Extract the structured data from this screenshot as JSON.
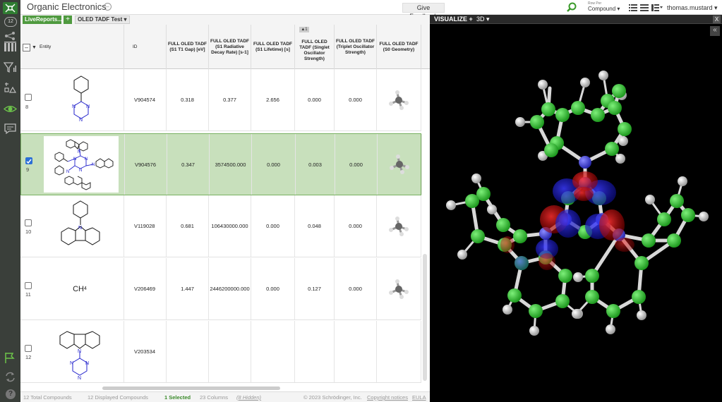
{
  "app": {
    "title": "Organic Electronics",
    "feedback": "Give Feedback",
    "row_per_label": "Row Per",
    "row_per_value": "Compound ▾",
    "user": "thomas.mustard ▾",
    "rail_badge": "12"
  },
  "tabs": {
    "livereport": "LiveReports...",
    "add": "+",
    "current": "OLED TADF Test ▾"
  },
  "grid": {
    "columns": [
      {
        "label": "Entity"
      },
      {
        "label": "ID"
      },
      {
        "label": "FULL OLED TADF (S1 T1 Gap) [eV]"
      },
      {
        "label": "FULL OLED TADF (S1 Radiative Decay Rate) [s-1]"
      },
      {
        "label": "FULL OLED TADF (S1 Lifetime) [s]"
      },
      {
        "label": "FULL OLED TADF (Singlet Oscillator Strength)"
      },
      {
        "label": "FULL OLED TADF (Triplet Oscillator Strength)"
      },
      {
        "label": "FULL OLED TADF (S0 Geometry)"
      }
    ],
    "sort_badge": "▲1",
    "rows": [
      {
        "num": "8",
        "id": "V904574",
        "gap": "0.318",
        "rate": "0.377",
        "life": "2.656",
        "sing": "0.000",
        "trip": "0.000"
      },
      {
        "num": "9",
        "id": "V904576",
        "gap": "0.347",
        "rate": "3574500.000",
        "life": "0.000",
        "sing": "0.003",
        "trip": "0.000"
      },
      {
        "num": "10",
        "id": "V119028",
        "gap": "0.681",
        "rate": "106430000.000",
        "life": "0.000",
        "sing": "0.048",
        "trip": "0.000"
      },
      {
        "num": "11",
        "id": "V206469",
        "gap": "1.447",
        "rate": "2446200000.000",
        "life": "0.000",
        "sing": "0.127",
        "trip": "0.000",
        "entity_text": "CH",
        "entity_sub": "4"
      },
      {
        "num": "12",
        "id": "V203534",
        "gap": "",
        "rate": "",
        "life": "",
        "sing": "",
        "trip": ""
      }
    ]
  },
  "status": {
    "total": "12 Total Compounds",
    "displayed": "12 Displayed Compounds",
    "selected": "1 Selected",
    "columns": "23 Columns",
    "hidden": "(8 Hidden)",
    "copyright": "© 2023 Schrödinger, Inc.",
    "notices": "Copyright notices",
    "eula": "EULA"
  },
  "viz": {
    "label": "VISUALIZE +",
    "mode": "3D ▾",
    "close": "X",
    "collapse": "«"
  },
  "colors": {
    "accent": "#4f9a3f",
    "selected_row": "#c8e0bc",
    "rail": "#3a3f3a"
  }
}
